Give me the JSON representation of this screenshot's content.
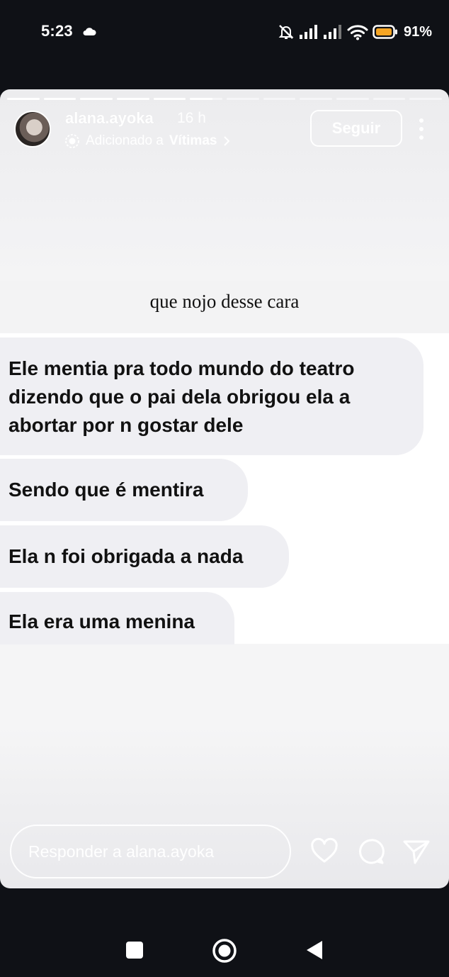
{
  "status_bar": {
    "time": "5:23",
    "battery": "91%"
  },
  "story": {
    "progress": {
      "segments": 12,
      "current_index": 5,
      "current_fill": 0.7
    },
    "username": "alana.ayoka",
    "time_ago": "16 h",
    "added_prefix": "Adicionado a",
    "added_collection": "Vítimas",
    "follow_label": "Seguir",
    "caption": "que nojo desse cara",
    "messages": [
      "Ele mentia pra todo mundo do teatro dizendo que o pai dela obrigou ela a abortar por n gostar dele",
      "Sendo que é mentira",
      "Ela n foi obrigada a nada",
      "Ela era uma menina"
    ],
    "reply_placeholder": "Responder a alana.ayoka"
  },
  "colors": {
    "battery_accent": "#f5a524",
    "bubble": "#efeff3",
    "background": "#0f1116"
  }
}
